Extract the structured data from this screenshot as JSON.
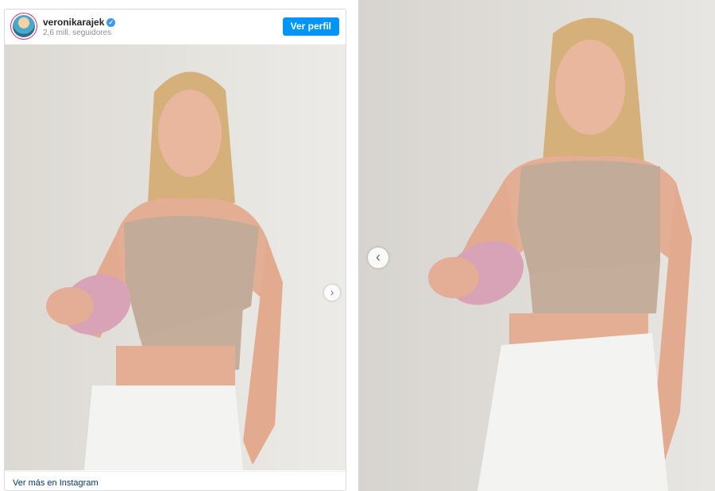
{
  "post": {
    "username": "veronikarajek",
    "verified_icon": "verified-check-icon",
    "followers": "2,6 mill. seguidores",
    "profile_button": "Ver perfil",
    "footer_link": "Ver más en Instagram",
    "next_icon": "chevron-right-icon"
  },
  "second_panel": {
    "prev_icon": "chevron-left-icon"
  }
}
